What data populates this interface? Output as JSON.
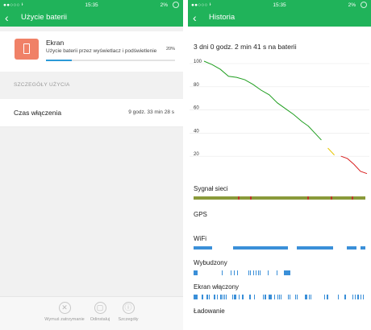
{
  "left": {
    "status": {
      "dots": "●●○○○",
      "network": "ᵻ",
      "time": "15:35",
      "battery": "2%"
    },
    "title": "Użycie baterii",
    "ekran": {
      "name": "Ekran",
      "description": "Użycie baterii przez wyświetlacz i podświetlenie",
      "percent_label": "20%",
      "percent": 0.2
    },
    "section_title": "SZCZEGÓŁY UŻYCIA",
    "detail": {
      "label": "Czas włączenia",
      "value": "9 godz. 33 min 28 s"
    },
    "bottom_bar": [
      {
        "icon": "force-stop-icon",
        "glyph": "✕",
        "label": "Wymuś zatrzymanie"
      },
      {
        "icon": "uninstall-icon",
        "glyph": "▢",
        "label": "Odinstaluj"
      },
      {
        "icon": "info-icon",
        "glyph": "ⓘ",
        "label": "Szczegóły"
      }
    ]
  },
  "right": {
    "status": {
      "dots": "●●○○○",
      "network": "ᵻ",
      "time": "15:35",
      "battery": "2%"
    },
    "title": "Historia",
    "summary": "3 dni 0 godz. 2 min 41 s na baterii",
    "chart_data": {
      "type": "line",
      "title": "",
      "xlabel": "",
      "ylabel": "",
      "yticks": [
        100,
        80,
        60,
        40,
        20
      ],
      "ylim": [
        0,
        100
      ],
      "series": [
        {
          "color_segments": [
            {
              "color": "#1f9e1f",
              "from": 0,
              "to": 0.74
            },
            {
              "color": "#e6c500",
              "from": 0.74,
              "to": 0.83
            },
            {
              "color": "#d92020",
              "from": 0.83,
              "to": 1.0
            }
          ],
          "x": [
            0,
            0.05,
            0.1,
            0.15,
            0.2,
            0.25,
            0.3,
            0.35,
            0.4,
            0.45,
            0.5,
            0.55,
            0.6,
            0.64,
            0.68,
            0.72,
            0.76,
            0.8,
            0.84,
            0.88,
            0.92,
            0.96,
            1.0
          ],
          "values": [
            100,
            97,
            93,
            87,
            86,
            84,
            80,
            75,
            71,
            64,
            59,
            54,
            48,
            44,
            38,
            32,
            25,
            19,
            18,
            16,
            11,
            5,
            3
          ]
        }
      ]
    },
    "timelines": [
      {
        "label": "Sygnał sieci",
        "kind": "signal"
      },
      {
        "label": "GPS",
        "kind": "empty"
      },
      {
        "label": "WiFi",
        "kind": "wifi"
      },
      {
        "label": "Wybudzony",
        "kind": "ticks-sparse"
      },
      {
        "label": "Ekran włączony",
        "kind": "ticks-dense"
      },
      {
        "label": "Ładowanie",
        "kind": "empty"
      }
    ],
    "colors": {
      "accent": "#20b35a",
      "bar": "#3a8fd8",
      "signal_green": "#8a9a3a",
      "signal_red": "#c0392b"
    }
  }
}
